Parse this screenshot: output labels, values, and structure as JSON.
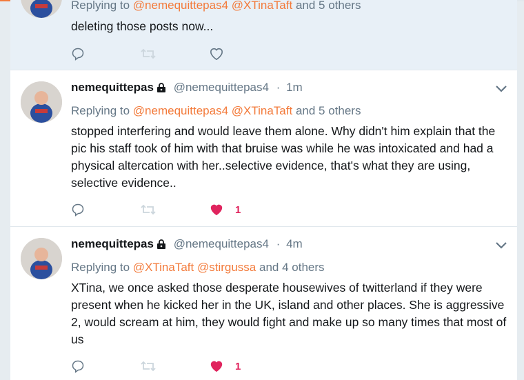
{
  "top_accent_color": "#f37a3a",
  "colors": {
    "mention": "#f37a3a",
    "like_active": "#e0245e",
    "muted": "#657786"
  },
  "tweets": [
    {
      "replying_prefix": "Replying to",
      "mentions": [
        "@nemequittepas4",
        "@XTinaTaft"
      ],
      "others": "and 5 others",
      "text": "deleting those posts now...",
      "like_count": ""
    },
    {
      "name": "nemequittepas",
      "handle": "@nemequittepas4",
      "dot": "·",
      "time": "1m",
      "replying_prefix": "Replying to",
      "mentions": [
        "@nemequittepas4",
        "@XTinaTaft"
      ],
      "others": "and 5 others",
      "text": "stopped interfering and would leave them alone. Why didn't him explain that the pic his staff took of him with that bruise was while he was intoxicated and had a physical altercation with her..selective evidence, that's what they are using, selective evidence..",
      "like_count": "1"
    },
    {
      "name": "nemequittepas",
      "handle": "@nemequittepas4",
      "dot": "·",
      "time": "4m",
      "replying_prefix": "Replying to",
      "mentions": [
        "@XTinaTaft",
        "@stirgussa"
      ],
      "others": "and 4 others",
      "text": "XTina, we once asked those desperate housewives of twitterland if they were present when he kicked her in the UK, island and other places. She is aggressive 2, would scream at him, they would fight and make up so many times that most of us",
      "like_count": "1"
    }
  ],
  "icons": {
    "reply": "reply-icon",
    "retweet": "retweet-icon",
    "like": "heart-icon",
    "lock": "lock-icon",
    "menu": "chevron-down-icon"
  }
}
